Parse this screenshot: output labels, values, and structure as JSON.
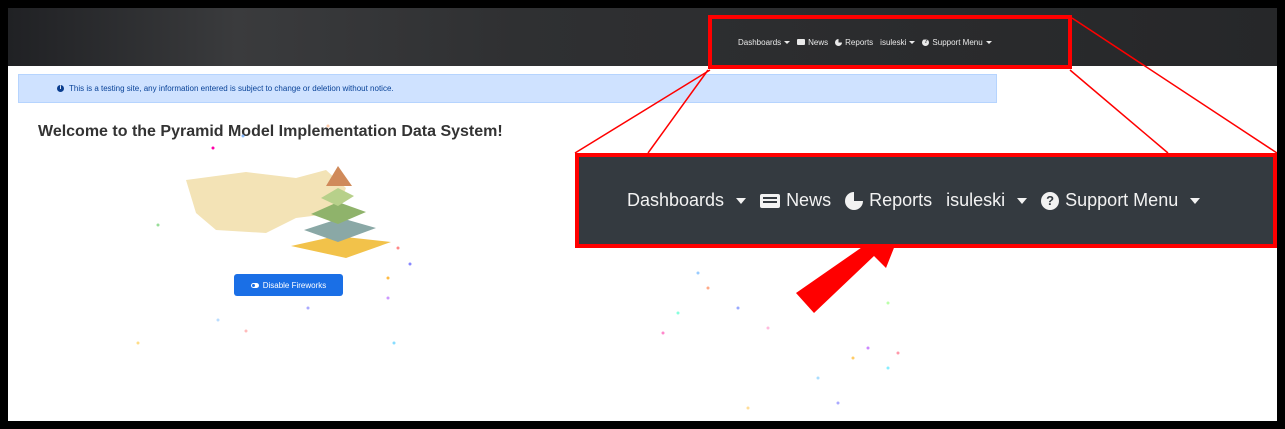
{
  "nav": {
    "dashboards": "Dashboards",
    "news": "News",
    "reports": "Reports",
    "user": "isuleski",
    "support": "Support Menu"
  },
  "alert": {
    "text": "This is a testing site, any information entered is subject to change or deletion without notice."
  },
  "page": {
    "welcome": "Welcome to the Pyramid Model Implementation Data System!"
  },
  "buttons": {
    "disable_fireworks": "Disable Fireworks"
  },
  "colors": {
    "highlight": "#ff0000",
    "navbar": "#343a40",
    "alert_bg": "#cfe2ff",
    "button": "#1a6fe6"
  },
  "icons": [
    "news-icon",
    "pie-chart-icon",
    "question-circle-icon",
    "info-icon",
    "toggle-icon",
    "caret-down-icon"
  ]
}
